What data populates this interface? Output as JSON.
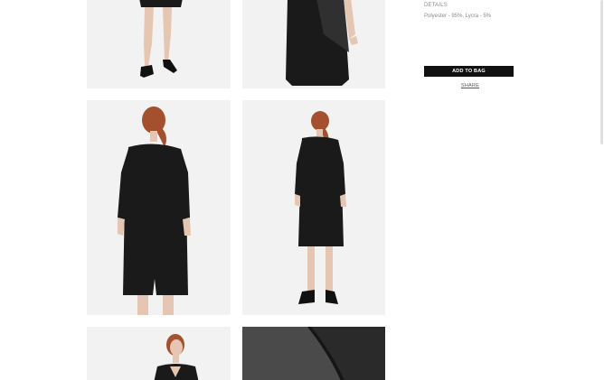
{
  "details": {
    "heading": "DETAILS",
    "composition": "Polyester - 95%, Lycra - 5%"
  },
  "actions": {
    "add_to_bag_label": "ADD TO BAG",
    "share_label": "SHARE"
  },
  "gallery": {
    "photo_count": 6
  },
  "colors": {
    "dress": "#1a1a1a",
    "button": "#111111",
    "background": "#ffffff",
    "hair": "#a4502f"
  }
}
